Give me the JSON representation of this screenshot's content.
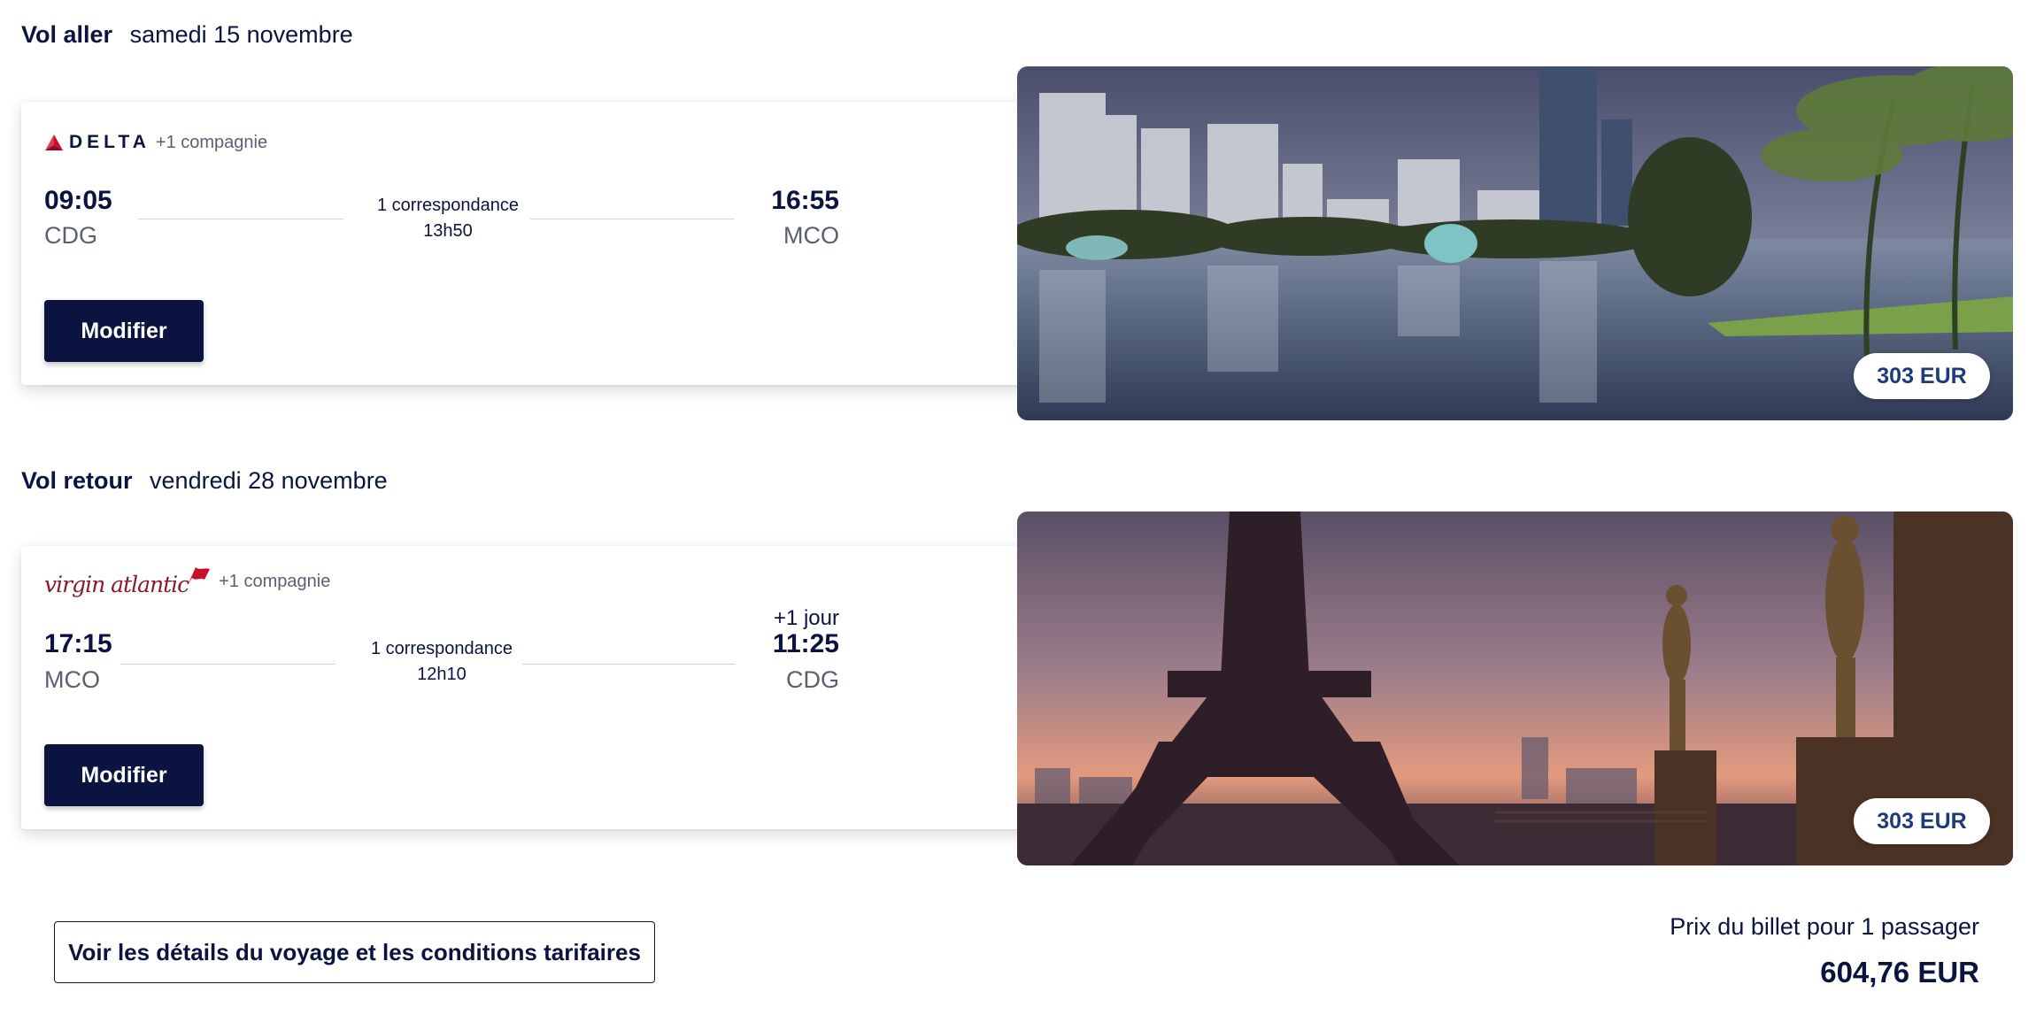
{
  "outbound": {
    "title": "Vol aller",
    "date": "samedi 15 novembre",
    "airline": "DELTA",
    "extra_company": "+1 compagnie",
    "departure_time": "09:05",
    "departure_airport": "CDG",
    "arrival_time": "16:55",
    "arrival_airport": "MCO",
    "connection": "1 correspondance",
    "duration": "13h50",
    "modify_label": "Modifier",
    "price": "303 EUR"
  },
  "return": {
    "title": "Vol retour",
    "date": "vendredi 28 novembre",
    "airline": "virgin atlantic",
    "extra_company": "+1 compagnie",
    "departure_time": "17:15",
    "departure_airport": "MCO",
    "arrival_time": "11:25",
    "arrival_airport": "CDG",
    "plus_day": "+1 jour",
    "connection": "1 correspondance",
    "duration": "12h10",
    "modify_label": "Modifier",
    "price": "303 EUR"
  },
  "footer": {
    "details_link": "Voir les détails du voyage et les conditions tarifaires",
    "total_label": "Prix du billet pour 1 passager",
    "total_value": "604,76 EUR"
  },
  "colors": {
    "navy": "#0b1440",
    "muted": "#5a6070",
    "price_blue": "#1d3a7a",
    "virgin_red": "#8a1a2a",
    "delta_red": "#c8102e"
  },
  "icons": {
    "delta": "delta-widget-icon",
    "virgin": "virgin-flag-icon"
  }
}
